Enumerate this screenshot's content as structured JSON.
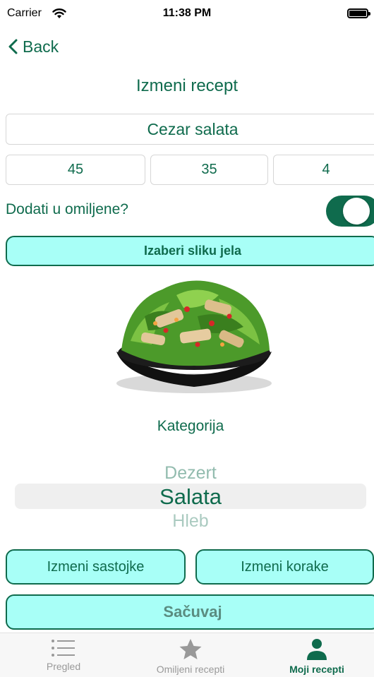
{
  "status_bar": {
    "carrier": "Carrier",
    "time": "11:38 PM"
  },
  "nav": {
    "back_label": "Back"
  },
  "page": {
    "title": "Izmeni recept"
  },
  "form": {
    "name_value": "Cezar salata",
    "fields": [
      "45",
      "35",
      "4"
    ],
    "favorite_label": "Dodati u omiljene?",
    "favorite_on": true,
    "choose_image_label": "Izaberi sliku jela"
  },
  "category": {
    "label": "Kategorija",
    "picker": {
      "previous": "Dezert",
      "selected": "Salata",
      "next": "Hleb"
    }
  },
  "actions": {
    "edit_ingredients": "Izmeni sastojke",
    "edit_steps": "Izmeni korake",
    "save": "Sačuvaj"
  },
  "tabs": [
    {
      "label": "Pregled",
      "icon": "list-icon",
      "active": false
    },
    {
      "label": "Omiljeni recepti",
      "icon": "star-icon",
      "active": false
    },
    {
      "label": "Moji recepti",
      "icon": "person-icon",
      "active": true
    }
  ],
  "colors": {
    "accent": "#0f6b4d",
    "button_fill": "#a8fff7",
    "inactive_tab": "#999999"
  }
}
